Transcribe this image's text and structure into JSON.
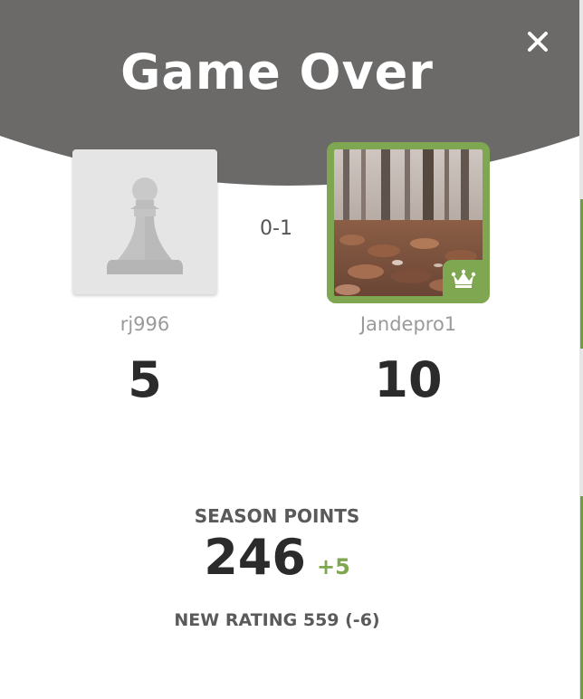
{
  "header": {
    "title": "Game Over",
    "close_icon": "close-icon",
    "background_color": "#6b6a68"
  },
  "players": {
    "left": {
      "username": "rj996",
      "score": "5",
      "avatar_icon": "pawn-icon"
    },
    "right": {
      "username": "Jandepro1",
      "score": "10",
      "winner_icon": "crown-icon",
      "accent_color": "#7fa650"
    }
  },
  "result": "0-1",
  "season": {
    "label": "SEASON POINTS",
    "points": "246",
    "delta": "+5"
  },
  "rating": {
    "text": "NEW RATING 559 (-6)"
  }
}
